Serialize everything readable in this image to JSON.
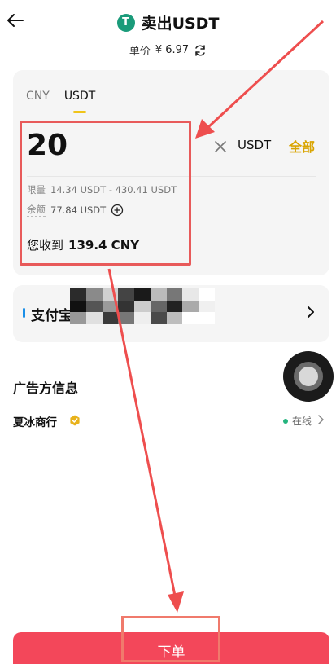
{
  "header": {
    "title": "卖出USDT",
    "coin_symbol": "T"
  },
  "price": {
    "label": "单价",
    "value": "¥ 6.97"
  },
  "trade": {
    "tabs": [
      {
        "label": "CNY",
        "active": false
      },
      {
        "label": "USDT",
        "active": true
      }
    ],
    "amount": "20",
    "unit": "USDT",
    "all_label": "全部",
    "limit_label": "限量",
    "limit_value": "14.34 USDT - 430.41 USDT",
    "balance_label": "余额",
    "balance_value": "77.84 USDT",
    "receive_label": "您收到",
    "receive_value": "139.4 CNY"
  },
  "payment": {
    "method": "支付宝"
  },
  "advertiser": {
    "section_title": "广告方信息",
    "merchant_name": "夏冰商行",
    "status": "在线"
  },
  "order_button": {
    "label": "下单"
  },
  "colors": {
    "accent_yellow": "#d9a400",
    "order_red": "#f3475a",
    "annotation_red": "#e85a5a",
    "online_green": "#24b47e",
    "coin_green": "#1a9b7a"
  }
}
